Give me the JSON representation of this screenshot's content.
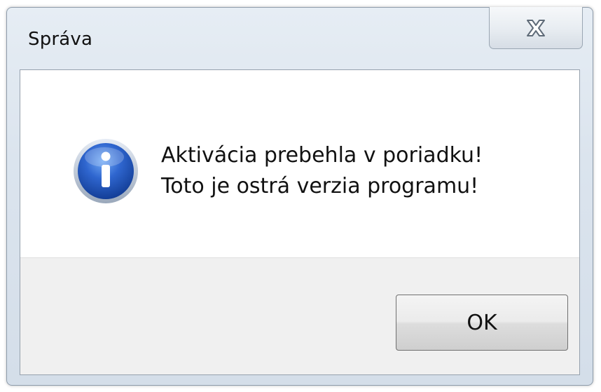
{
  "window": {
    "title": "Správa"
  },
  "titlebar": {
    "close_icon": "close-icon"
  },
  "dialog": {
    "icon": "info-icon",
    "message_lines": [
      "Aktivácia prebehla v poriadku!",
      "Toto je ostrá verzia programu!"
    ],
    "ok_label": "OK"
  },
  "colors": {
    "frame": "#dbe4ee",
    "icon_blue": "#1f4fb0",
    "footer": "#f0f0f0"
  }
}
